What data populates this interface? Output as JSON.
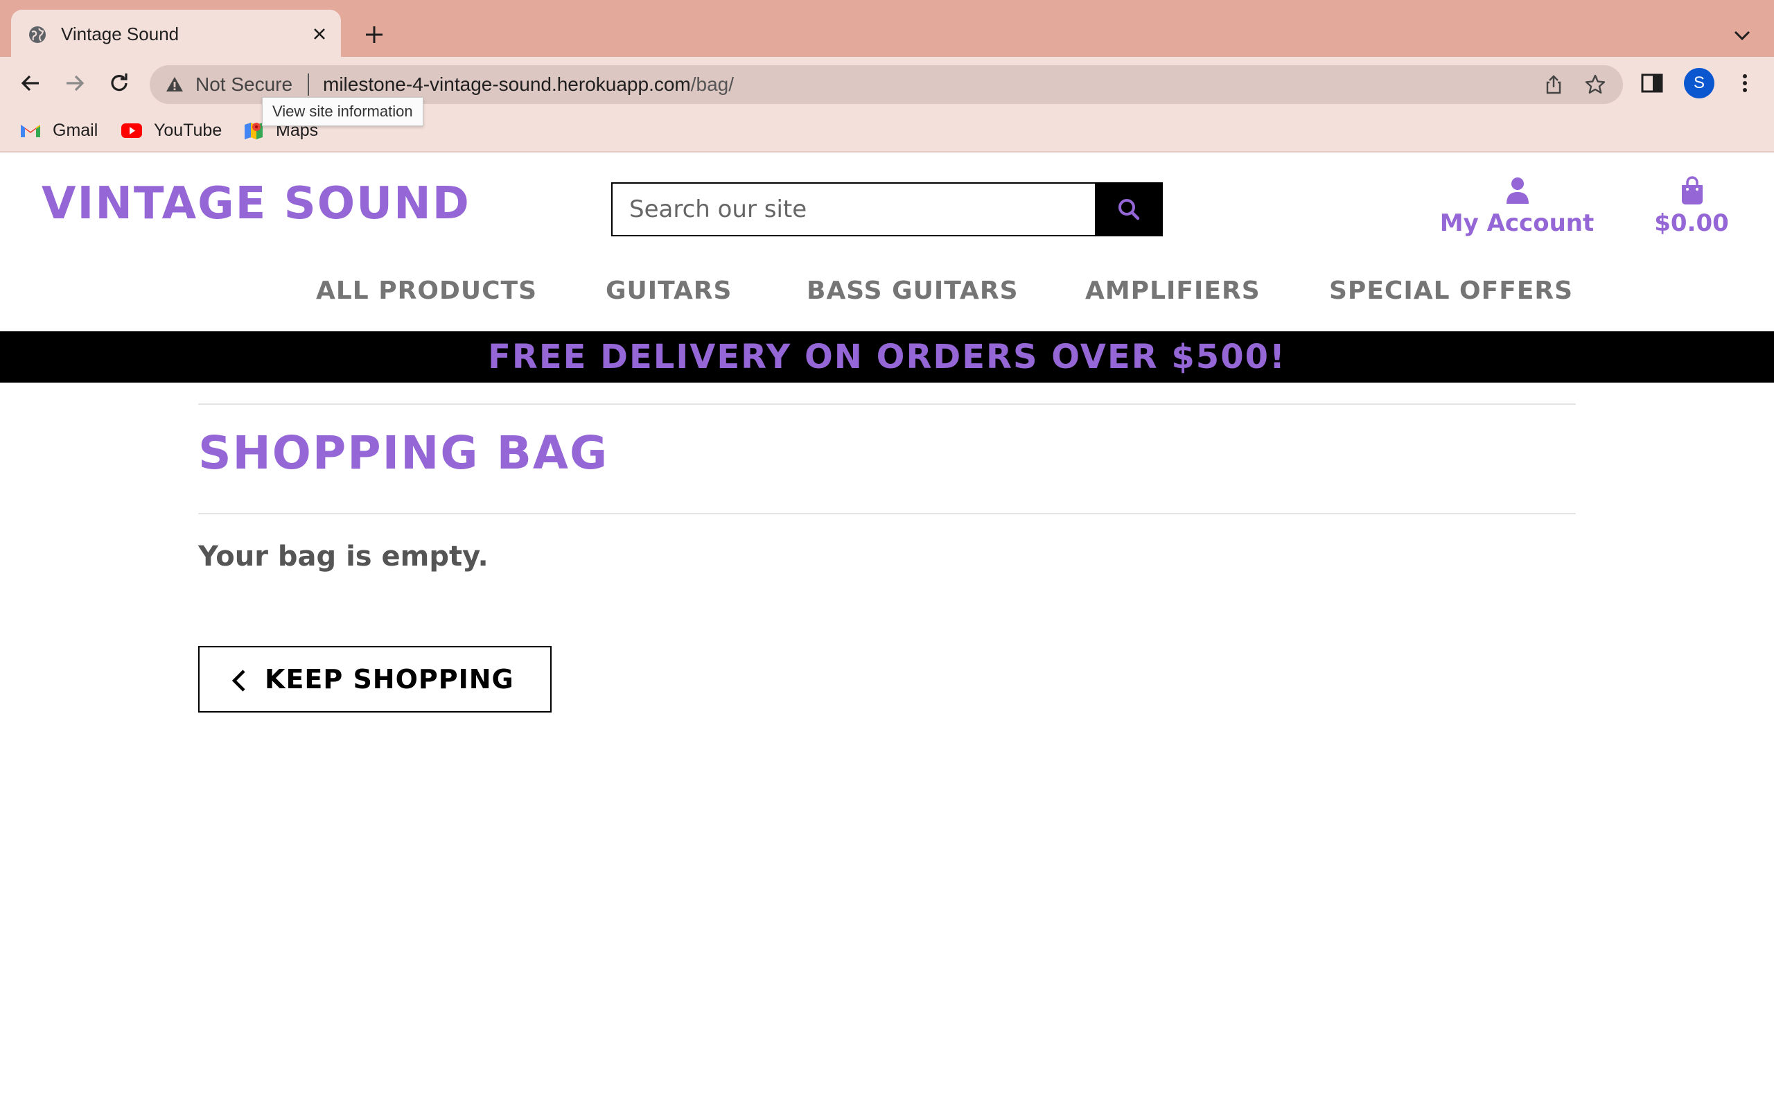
{
  "browser": {
    "tab_title": "Vintage Sound",
    "security_label": "Not Secure",
    "url_host": "milestone-4-vintage-sound.herokuapp.com",
    "url_path": "/bag/",
    "tooltip": "View site information",
    "profile_initial": "S",
    "bookmarks": [
      {
        "label": "Gmail",
        "icon": "gmail-icon"
      },
      {
        "label": "YouTube",
        "icon": "youtube-icon"
      },
      {
        "label": "Maps",
        "icon": "maps-icon"
      }
    ]
  },
  "site": {
    "logo": "VINTAGE SOUND",
    "search_placeholder": "Search our site",
    "account_label": "My Account",
    "bag_total": "$0.00",
    "nav": [
      {
        "label": "ALL PRODUCTS"
      },
      {
        "label": "GUITARS"
      },
      {
        "label": "BASS GUITARS"
      },
      {
        "label": "AMPLIFIERS"
      },
      {
        "label": "SPECIAL OFFERS"
      }
    ],
    "banner": "FREE DELIVERY ON ORDERS OVER $500!"
  },
  "page": {
    "title": "SHOPPING BAG",
    "empty_message": "Your bag is empty.",
    "keep_shopping": "KEEP SHOPPING"
  },
  "colors": {
    "brand": "#9466d6",
    "tabbar": "#e3aa9b",
    "toolbar": "#f4e0db"
  }
}
